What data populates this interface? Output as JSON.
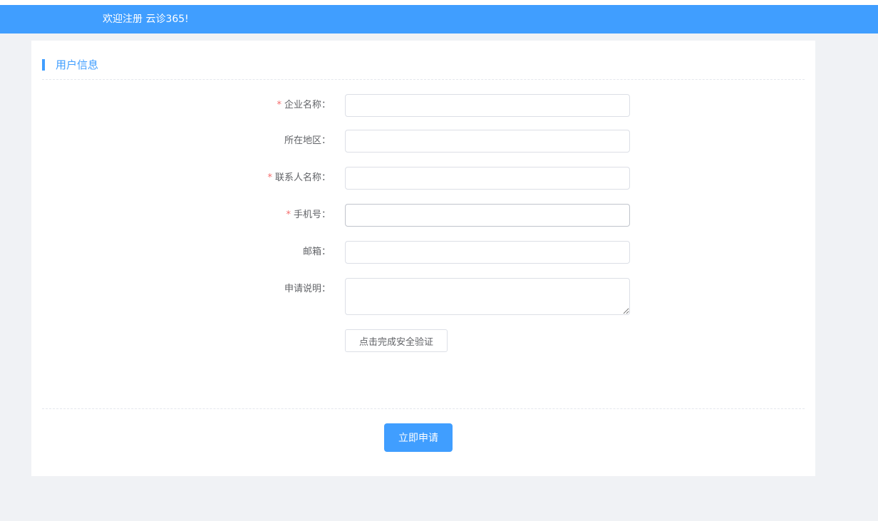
{
  "header": {
    "title": "欢迎注册 云诊365!"
  },
  "section": {
    "title": "用户信息"
  },
  "form": {
    "required_mark": "*",
    "fields": [
      {
        "label": "企业名称：",
        "required": true,
        "value": ""
      },
      {
        "label": "所在地区：",
        "required": false,
        "value": ""
      },
      {
        "label": "联系人名称：",
        "required": true,
        "value": ""
      },
      {
        "label": "手机号：",
        "required": true,
        "value": ""
      },
      {
        "label": "邮箱：",
        "required": false,
        "value": ""
      },
      {
        "label": "申请说明：",
        "required": false,
        "value": ""
      }
    ],
    "verify_button": "点击完成安全验证",
    "submit_button": "立即申请"
  },
  "colors": {
    "accent": "#409eff",
    "required": "#f56c6c",
    "background": "#f0f2f5"
  }
}
